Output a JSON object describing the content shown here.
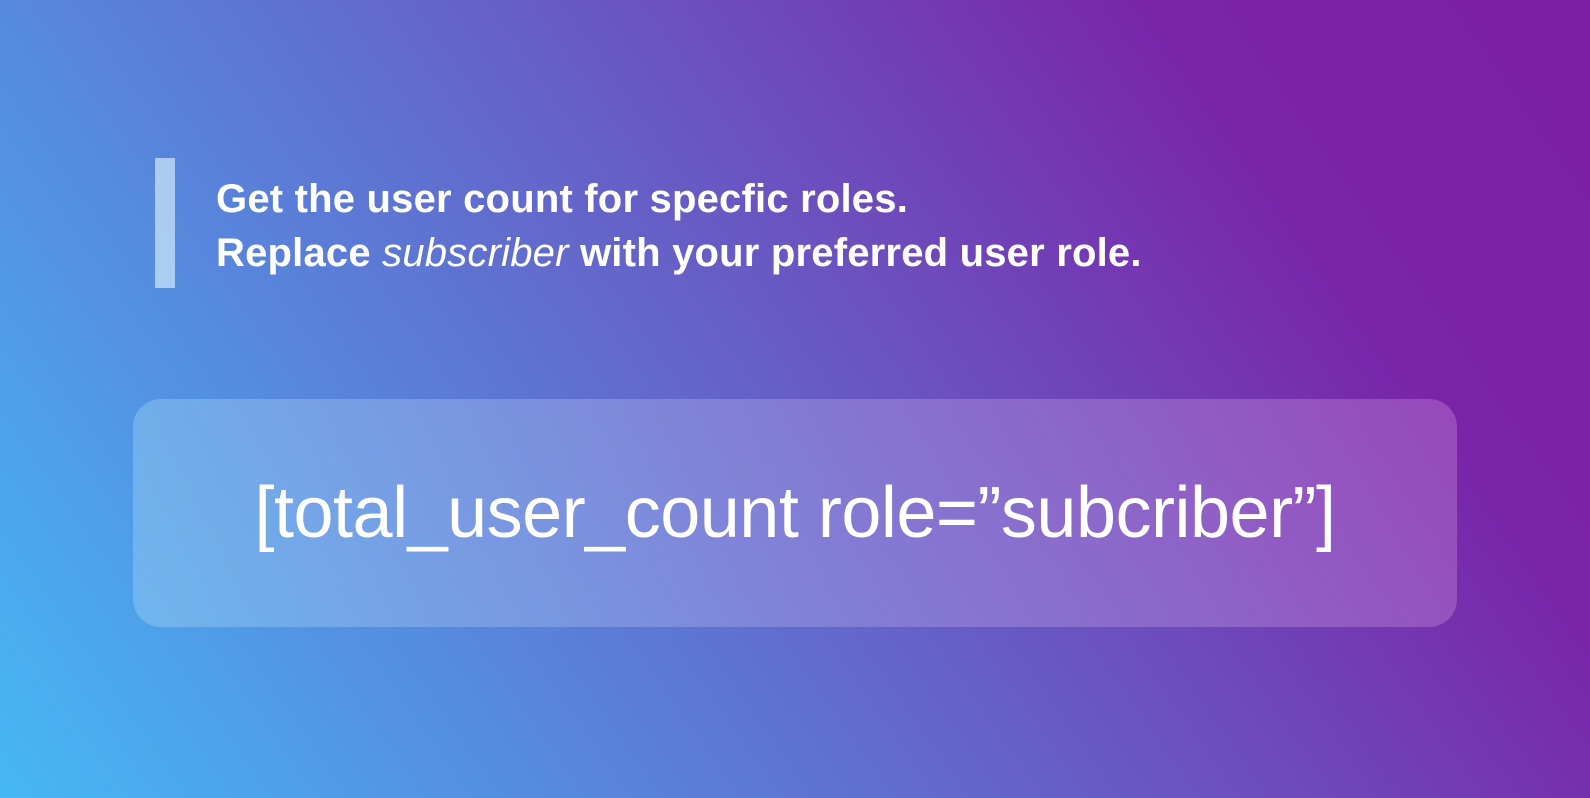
{
  "colors": {
    "gradient_start": "#46b8f4",
    "gradient_end": "#7b1fa2",
    "text": "#ffffff"
  },
  "instruction": {
    "line1": "Get the user count for specfic roles.",
    "line2_prefix": "Replace ",
    "line2_emphasis": "subscriber",
    "line2_suffix": " with your preferred user role."
  },
  "code": {
    "shortcode": "[total_user_count role=”subcriber”]"
  }
}
